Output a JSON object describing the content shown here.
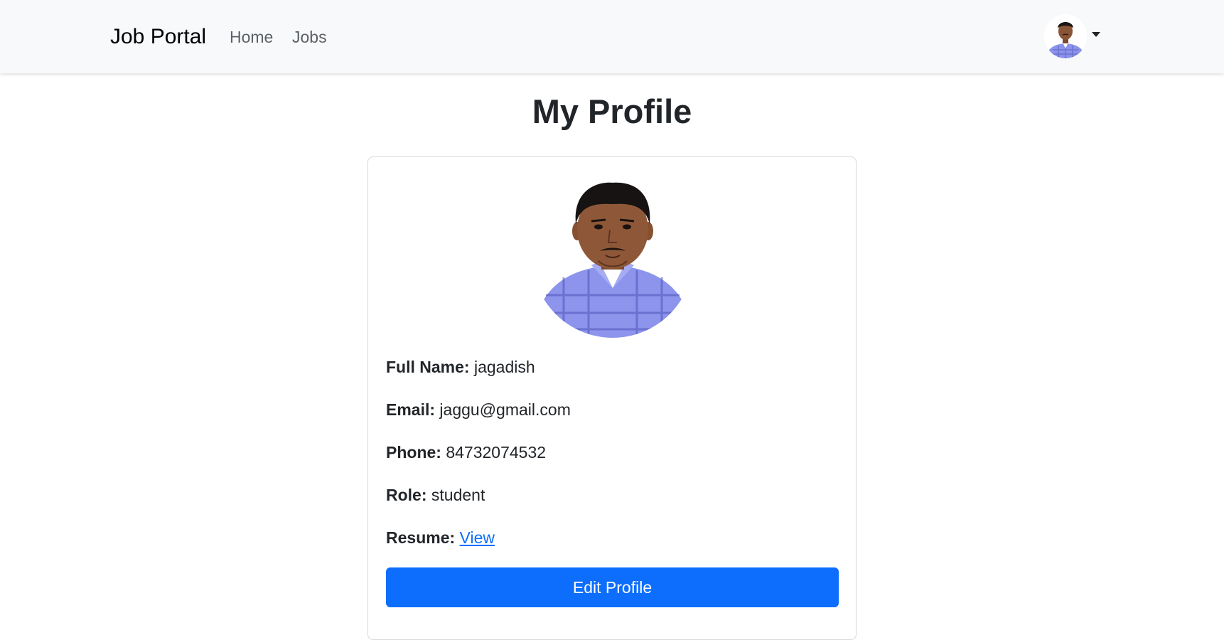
{
  "navbar": {
    "brand": "Job Portal",
    "links": [
      {
        "label": "Home"
      },
      {
        "label": "Jobs"
      }
    ],
    "user_avatar_icon": "user-avatar",
    "dropdown_icon": "caret-down-icon"
  },
  "page": {
    "title": "My Profile"
  },
  "profile": {
    "photo_icon": "profile-photo",
    "fields": {
      "full_name": {
        "label": "Full Name:",
        "value": "jagadish"
      },
      "email": {
        "label": "Email:",
        "value": "jaggu@gmail.com"
      },
      "phone": {
        "label": "Phone:",
        "value": "84732074532"
      },
      "role": {
        "label": "Role:",
        "value": "student"
      },
      "resume": {
        "label": "Resume:",
        "link_text": "View"
      }
    },
    "edit_button": "Edit Profile"
  },
  "colors": {
    "primary": "#0d6efd",
    "navbar_bg": "#f8f9fa",
    "text": "#212529"
  }
}
